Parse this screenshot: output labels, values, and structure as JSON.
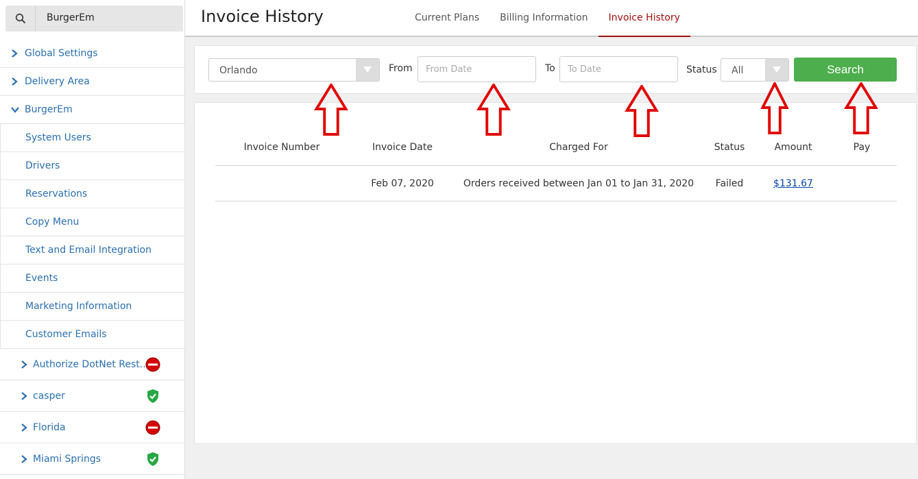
{
  "sidebar": {
    "search_value": "BurgerEm",
    "top_items": [
      {
        "label": "Global Settings",
        "expanded": false
      },
      {
        "label": "Delivery Area",
        "expanded": false
      },
      {
        "label": "BurgerEm",
        "expanded": true
      }
    ],
    "sub_items": [
      "System Users",
      "Drivers",
      "Reservations",
      "Copy Menu",
      "Text and Email Integration",
      "Events",
      "Marketing Information",
      "Customer Emails"
    ],
    "locations": [
      {
        "label": "Authorize DotNet Rest...",
        "status": "blocked"
      },
      {
        "label": "casper",
        "status": "verified"
      },
      {
        "label": "Florida",
        "status": "blocked"
      },
      {
        "label": "Miami Springs",
        "status": "verified"
      }
    ]
  },
  "header": {
    "title": "Invoice History",
    "tabs": [
      "Current Plans",
      "Billing Information",
      "Invoice History"
    ],
    "active_tab": "Invoice History"
  },
  "filters": {
    "location_value": "Orlando",
    "from_label": "From",
    "from_placeholder": "From Date",
    "to_label": "To",
    "to_placeholder": "To Date",
    "status_label": "Status",
    "status_value": "All",
    "search_label": "Search"
  },
  "table": {
    "headers": [
      "Invoice Number",
      "Invoice Date",
      "Charged For",
      "Status",
      "Amount",
      "Pay"
    ],
    "rows": [
      {
        "invoice_number": "",
        "invoice_date": "Feb 07, 2020",
        "charged_for": "Orders received between Jan 01 to Jan 31, 2020",
        "status": "Failed",
        "amount": "$131.67",
        "pay": ""
      }
    ]
  },
  "colors": {
    "accent": "#a50f0f",
    "link": "#2a6fb0",
    "search_button": "#4cae4c",
    "annotation_arrow": "#e00000",
    "status_blocked": "#d40000",
    "status_verified": "#27a745"
  }
}
